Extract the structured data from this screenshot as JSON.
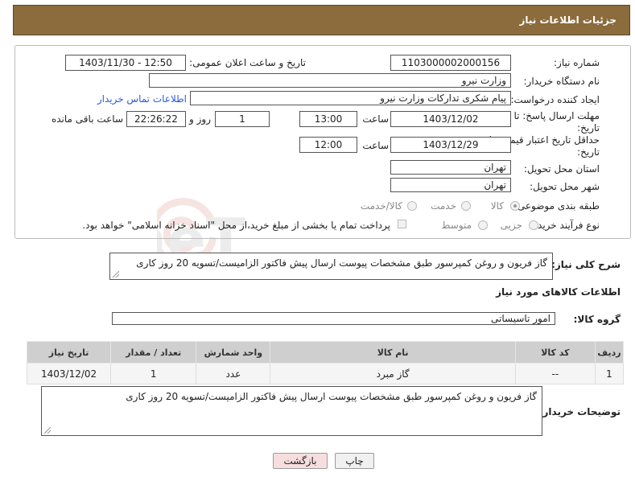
{
  "header": {
    "title": "جزئیات اطلاعات نیاز"
  },
  "form": {
    "need_number_label": "شماره نیاز:",
    "need_number": "1103000002000156",
    "announce_label": "تاریخ و ساعت اعلان عمومی:",
    "announce_value": "1403/11/30 - 12:50",
    "buyer_org_label": "نام دستگاه خریدار:",
    "buyer_org": "وزارت نیرو",
    "creator_label": "ایجاد کننده درخواست:",
    "creator": "پیام شکری تدارکات وزارت نیرو",
    "contact_link": "اطلاعات تماس خریدار",
    "reply_deadline_label_1": "مهلت ارسال پاسخ: تا",
    "reply_deadline_label_2": "تاریخ:",
    "reply_date": "1403/12/02",
    "time_label": "ساعت",
    "reply_time": "13:00",
    "days_value": "1",
    "days_label": "روز و",
    "remaining_time": "22:26:22",
    "remaining_label": "ساعت باقی مانده",
    "price_validity_label_1": "حداقل تاریخ اعتبار قیمت: تا",
    "price_validity_label_2": "تاریخ:",
    "price_date": "1403/12/29",
    "price_time": "12:00",
    "province_label": "استان محل تحویل:",
    "province": "تهران",
    "city_label": "شهر محل تحویل:",
    "city": "تهران",
    "category_label": "طبقه بندی موضوعی:",
    "category_options": [
      "کالا",
      "خدمت",
      "کالا/خدمت"
    ],
    "process_label": "نوع فرآیند خرید :",
    "process_options": [
      "جزیی",
      "متوسط"
    ],
    "payment_note": "پرداخت تمام یا بخشی از مبلغ خرید،از محل \"اسناد خزانه اسلامی\" خواهد بود."
  },
  "description": {
    "label": "شرح کلی نیاز:",
    "text": "گاز فریون و روغن کمپرسور طبق مشخصات پیوست ارسال پیش فاکتور الزامیست/تسویه 20 روز کاری"
  },
  "goods": {
    "section_title": "اطلاعات کالاهای مورد نیاز",
    "group_label": "گروه کالا:",
    "group_value": "امور تاسیساتی",
    "columns": [
      "ردیف",
      "کد کالا",
      "نام کالا",
      "واحد شمارش",
      "تعداد / مقدار",
      "تاریخ نیاز"
    ],
    "rows": [
      [
        "1",
        "--",
        "گاز مبرد",
        "عدد",
        "1",
        "1403/12/02"
      ]
    ]
  },
  "buyer_notes": {
    "label": "توضیحات خریدار:",
    "text": "گاز فریون و روغن کمپرسور طبق مشخصات پیوست ارسال پیش فاکتور الزامیست/تسویه 20 روز کاری"
  },
  "buttons": {
    "print": "چاپ",
    "back": "بازگشت"
  },
  "watermark": {
    "text": "AriaTender.neT"
  },
  "colors": {
    "header_bg": "#8c6c3c",
    "link": "#2a5bd7",
    "back_btn": "#f7dede"
  }
}
